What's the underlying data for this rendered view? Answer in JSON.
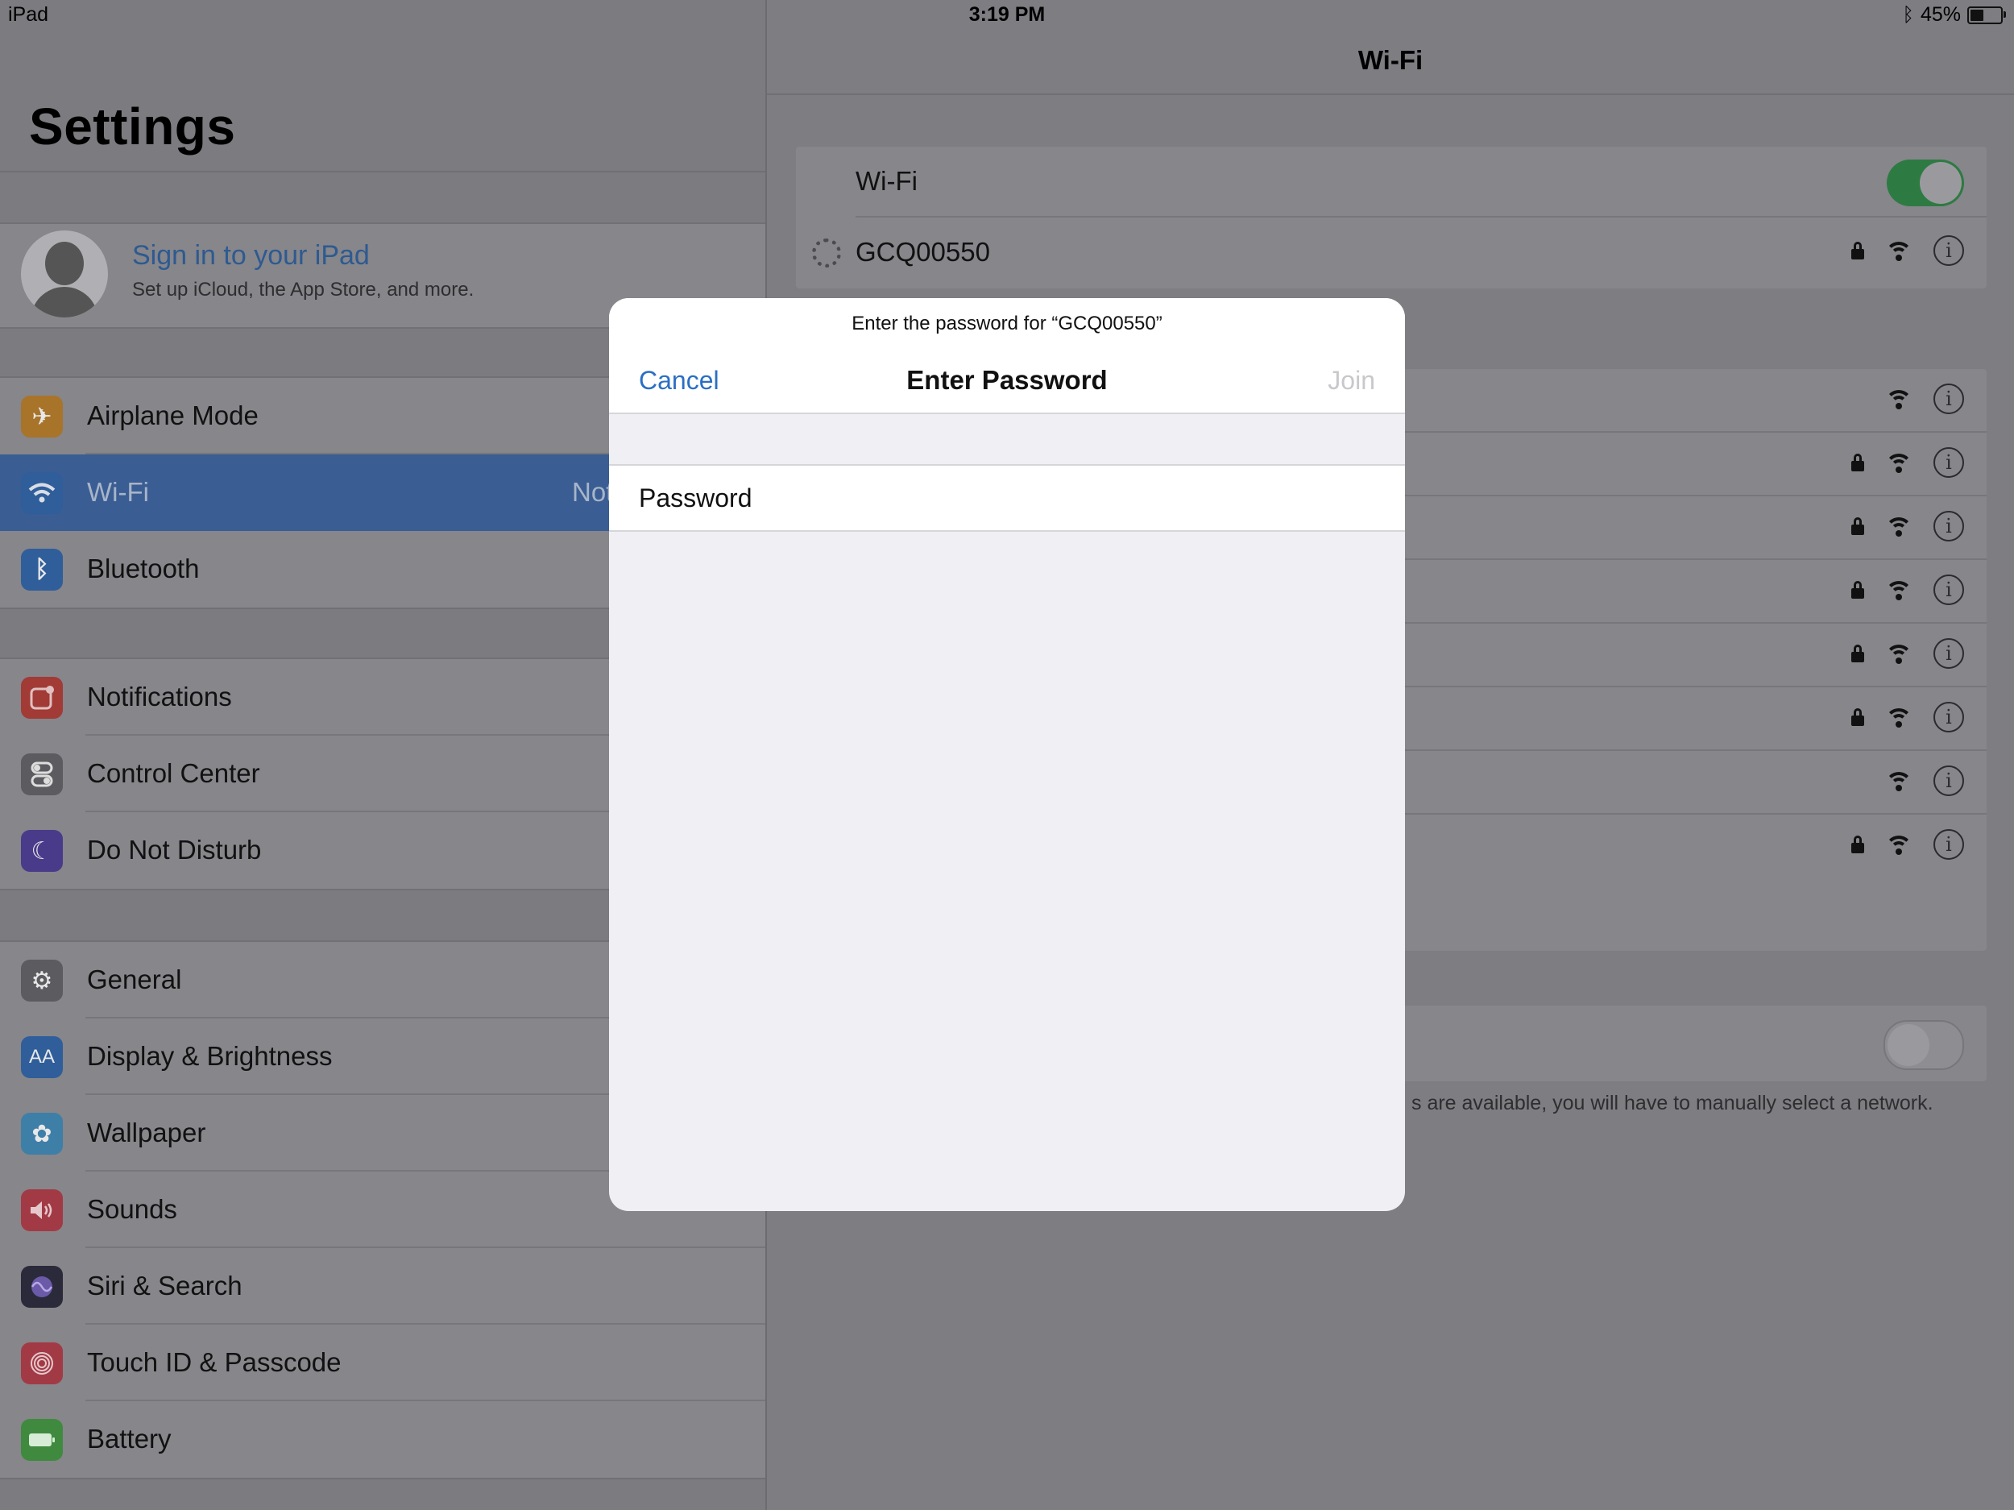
{
  "status_bar": {
    "device": "iPad",
    "time": "3:19 PM",
    "battery": "45%",
    "battery_level": 0.45
  },
  "sidebar": {
    "title": "Settings",
    "profile": {
      "name": "Sign in to your iPad",
      "subtitle": "Set up iCloud, the App Store, and more."
    },
    "groups": [
      [
        {
          "label": "Airplane Mode",
          "icon": "airplane-icon",
          "color": "#a8742a"
        },
        {
          "label": "Wi-Fi",
          "icon": "wifi-icon",
          "color": "#2f5e9a",
          "value": "Not",
          "selected": true
        },
        {
          "label": "Bluetooth",
          "icon": "bluetooth-icon",
          "color": "#2f5e9a"
        }
      ],
      [
        {
          "label": "Notifications",
          "icon": "notifications-icon",
          "color": "#a23a35"
        },
        {
          "label": "Control Center",
          "icon": "control-center-icon",
          "color": "#5b5b60"
        },
        {
          "label": "Do Not Disturb",
          "icon": "moon-icon",
          "color": "#4a3b8a"
        }
      ],
      [
        {
          "label": "General",
          "icon": "gear-icon",
          "color": "#5b5b60"
        },
        {
          "label": "Display & Brightness",
          "icon": "aa-icon",
          "color": "#2f5e9a"
        },
        {
          "label": "Wallpaper",
          "icon": "flower-icon",
          "color": "#3e7fa8"
        },
        {
          "label": "Sounds",
          "icon": "speaker-icon",
          "color": "#a23a45"
        },
        {
          "label": "Siri & Search",
          "icon": "siri-icon",
          "color": "#2a2a3a"
        },
        {
          "label": "Touch ID & Passcode",
          "icon": "fingerprint-icon",
          "color": "#a23a45"
        },
        {
          "label": "Battery",
          "icon": "battery-icon",
          "color": "#3f8a3f"
        }
      ]
    ]
  },
  "detail": {
    "title": "Wi-Fi",
    "wifi_label": "Wi-Fi",
    "wifi_on": true,
    "current_network": "GCQ00550",
    "other_networks": [
      {
        "locked": false
      },
      {
        "locked": true
      },
      {
        "locked": true
      },
      {
        "locked": true
      },
      {
        "locked": true
      },
      {
        "locked": true
      },
      {
        "locked": false
      },
      {
        "locked": true
      }
    ],
    "ask_to_join_on": false,
    "note": "s are available, you will have to manually select a network."
  },
  "modal": {
    "prompt": "Enter the password for “GCQ00550”",
    "cancel_label": "Cancel",
    "title": "Enter Password",
    "join_label": "Join",
    "password_label": "Password",
    "password_value": ""
  }
}
